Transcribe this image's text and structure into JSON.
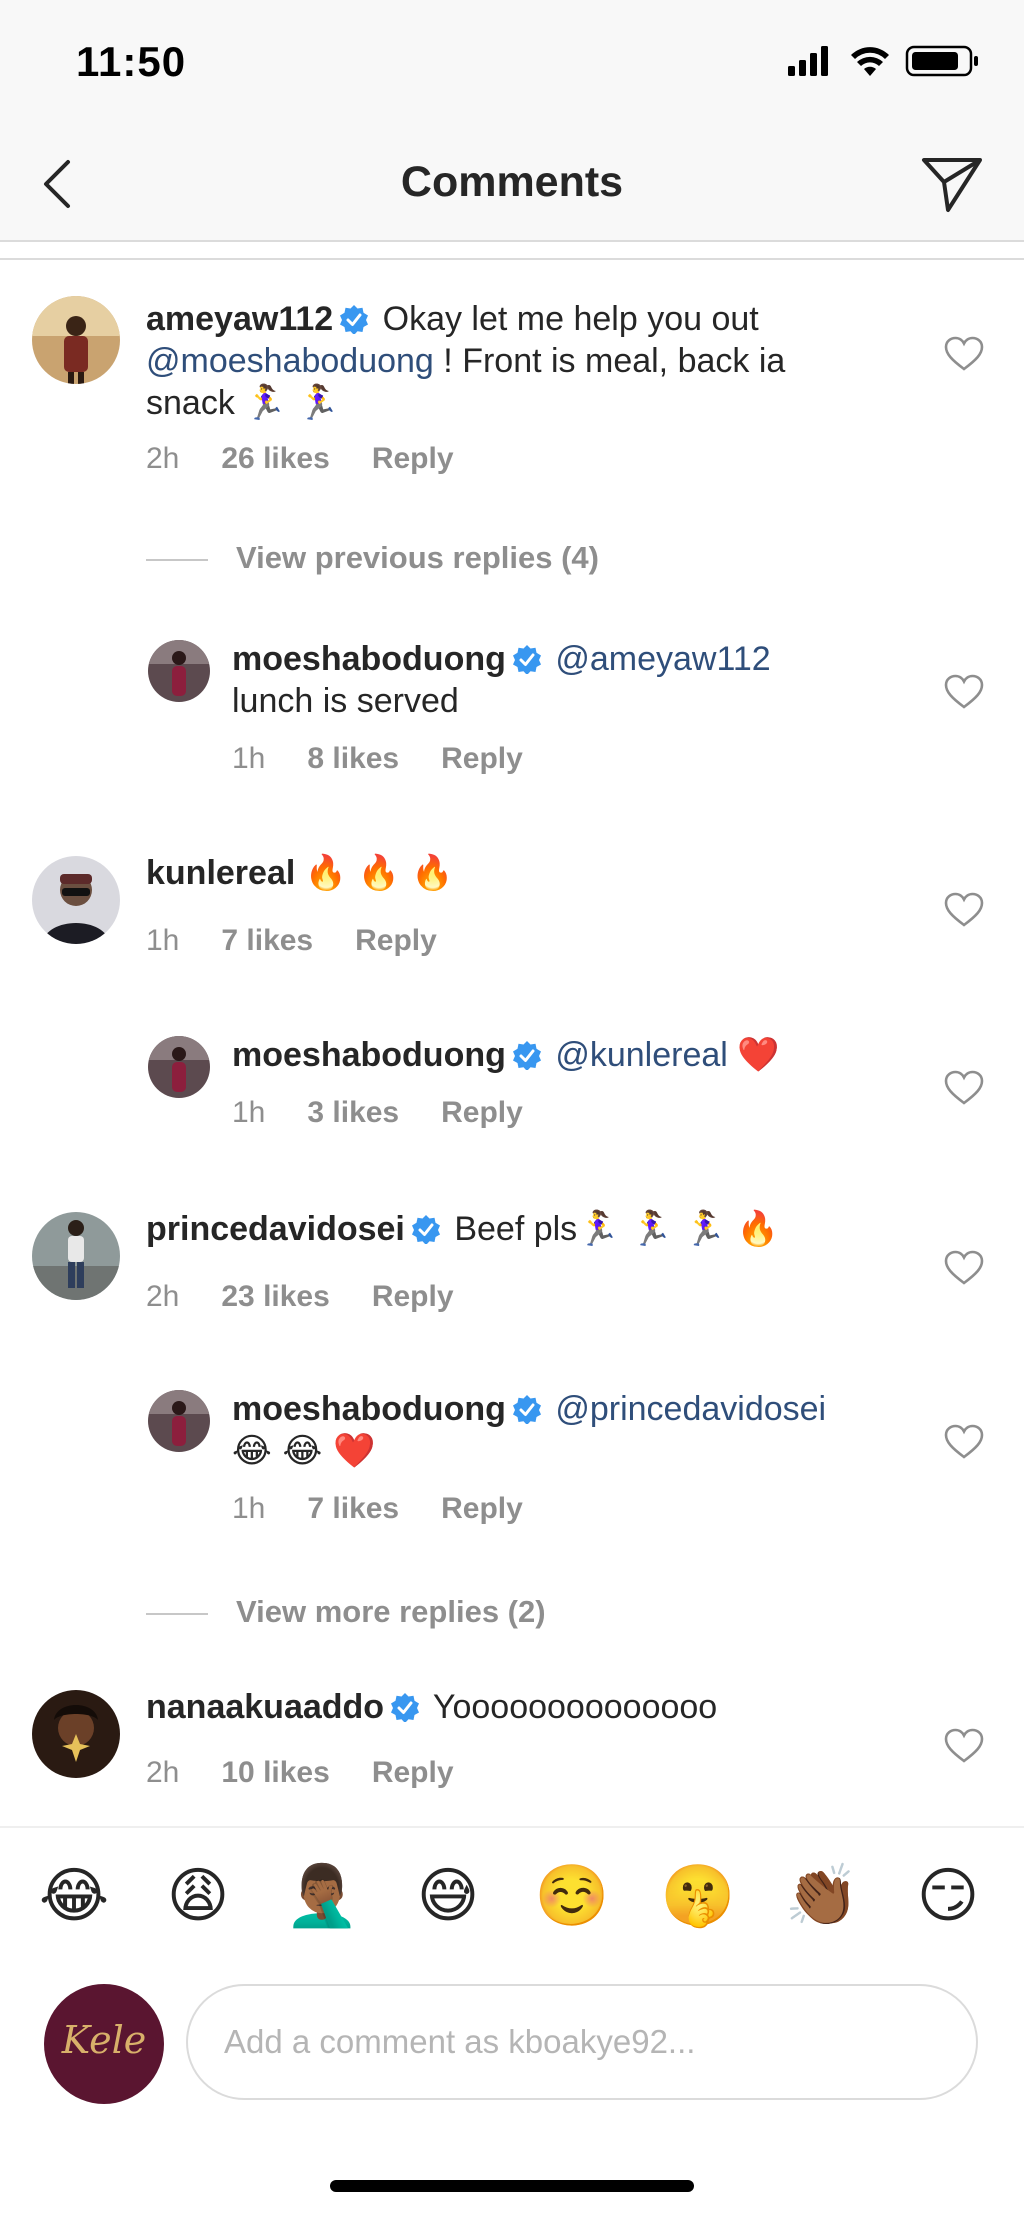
{
  "status": {
    "time": "11:50"
  },
  "nav": {
    "title": "Comments"
  },
  "comments": [
    {
      "user": "ameyaw112",
      "verified": true,
      "text_before": "Okay let me help you out",
      "mention": "@moeshaboduong",
      "text_after": "! Front is meal, back ia snack",
      "emoji": "🏃‍♀️ 🏃‍♀️",
      "time": "2h",
      "likes": "26 likes",
      "reply": "Reply"
    },
    {
      "user": "moeshaboduong",
      "verified": true,
      "mention": "@ameyaw112",
      "text_after": "lunch is served",
      "time": "1h",
      "likes": "8 likes",
      "reply": "Reply"
    },
    {
      "user": "kunlereal",
      "verified": false,
      "emoji": "🔥 🔥 🔥",
      "time": "1h",
      "likes": "7 likes",
      "reply": "Reply"
    },
    {
      "user": "moeshaboduong",
      "verified": true,
      "mention": "@kunlereal",
      "emoji": "❤️",
      "time": "1h",
      "likes": "3 likes",
      "reply": "Reply"
    },
    {
      "user": "princedavidosei",
      "verified": true,
      "text_after": "Beef pls",
      "emoji": "🏃‍♀️ 🏃‍♀️ 🏃‍♀️ 🔥",
      "time": "2h",
      "likes": "23 likes",
      "reply": "Reply"
    },
    {
      "user": "moeshaboduong",
      "verified": true,
      "mention": "@princedavidosei",
      "emoji": "😂 😂 ❤️",
      "time": "1h",
      "likes": "7 likes",
      "reply": "Reply"
    },
    {
      "user": "nanaakuaaddo",
      "verified": true,
      "text_after": "Yoooooooooooooo",
      "time": "2h",
      "likes": "10 likes",
      "reply": "Reply"
    }
  ],
  "view_previous": "View previous replies (4)",
  "view_more": "View more replies (2)",
  "emoji_bar": [
    "😂",
    "😩",
    "🤦🏾‍♂️",
    "😅",
    "☺️",
    "🤫",
    "👏🏾",
    "😏"
  ],
  "my_avatar_text": "Kele",
  "input": {
    "placeholder": "Add a comment as kboakye92..."
  },
  "colors": {
    "mention": "#2f4e7a",
    "verified": "#3897f0",
    "meta": "#8e8e8e"
  }
}
